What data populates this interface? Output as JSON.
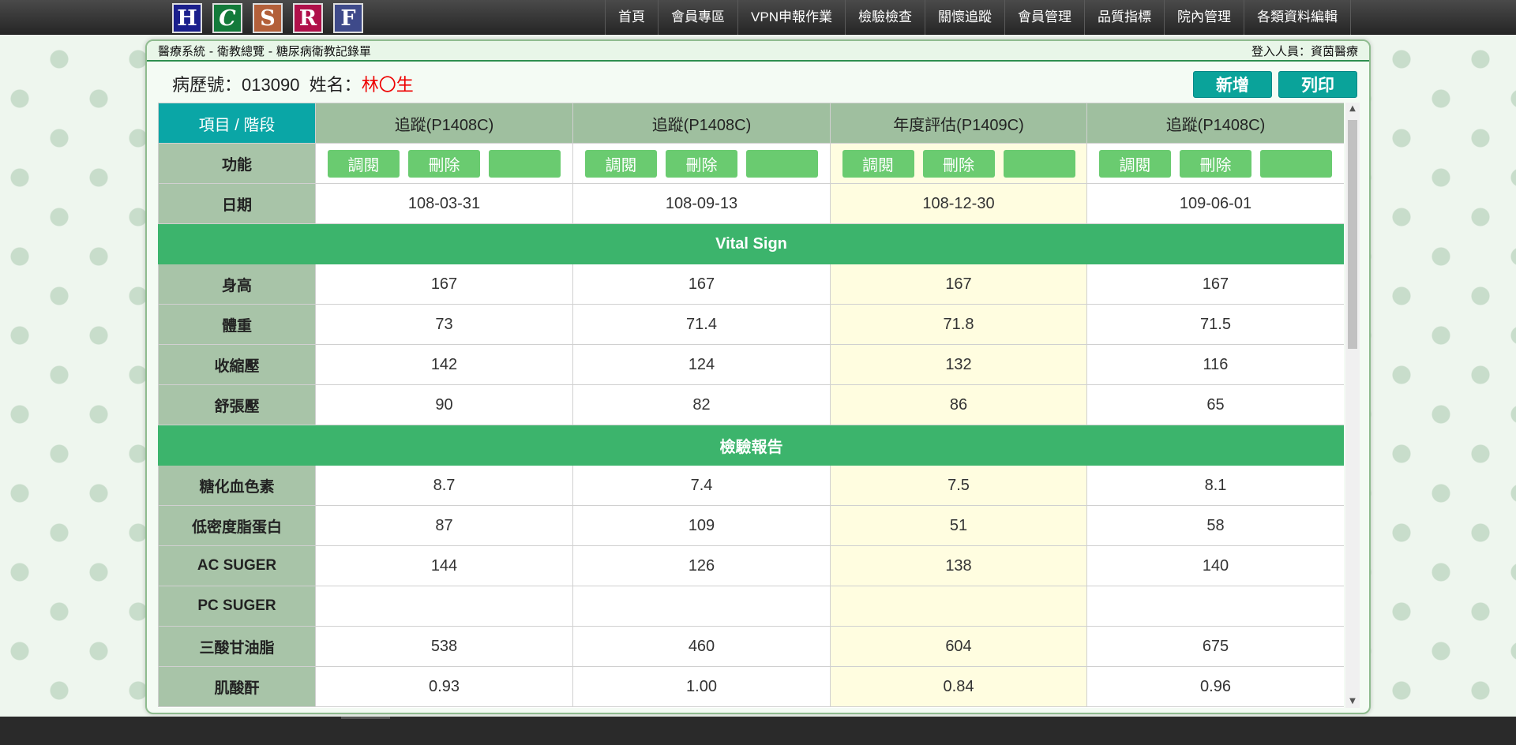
{
  "logos": [
    {
      "letter": "H",
      "color": "#1a1f8c"
    },
    {
      "letter": "C",
      "color": "#137a3a"
    },
    {
      "letter": "S",
      "color": "#b3603a"
    },
    {
      "letter": "R",
      "color": "#b0104a"
    },
    {
      "letter": "F",
      "color": "#3e4a8a"
    }
  ],
  "nav": [
    "首頁",
    "會員專區",
    "VPN申報作業",
    "檢驗檢查",
    "關懷追蹤",
    "會員管理",
    "品質指標",
    "院內管理",
    "各類資料編輯"
  ],
  "header": {
    "breadcrumb": "醫療系統 - 衛教總覽 - 糖尿病衛教記錄單",
    "user": "登入人員：資茵醫療"
  },
  "patient": {
    "record_label": "病歷號：",
    "record_no": "013090",
    "name_label": "姓名：",
    "name": "林〇生"
  },
  "buttons": {
    "add": "新增",
    "print": "列印"
  },
  "table": {
    "corner": "項目 / 階段",
    "columns": [
      "追蹤(P1408C)",
      "追蹤(P1408C)",
      "年度評估(P1409C)",
      "追蹤(P1408C)"
    ],
    "func_label": "功能",
    "view_label": "調閱",
    "delete_label": "刪除",
    "date_label": "日期",
    "dates": [
      "108-03-31",
      "108-09-13",
      "108-12-30",
      "109-06-01"
    ],
    "sections": [
      {
        "title": "Vital Sign",
        "rows": [
          {
            "label": "身高",
            "values": [
              "167",
              "167",
              "167",
              "167"
            ]
          },
          {
            "label": "體重",
            "values": [
              "73",
              "71.4",
              "71.8",
              "71.5"
            ]
          },
          {
            "label": "收縮壓",
            "values": [
              "142",
              "124",
              "132",
              "116"
            ]
          },
          {
            "label": "舒張壓",
            "values": [
              "90",
              "82",
              "86",
              "65"
            ]
          }
        ]
      },
      {
        "title": "檢驗報告",
        "rows": [
          {
            "label": "糖化血色素",
            "values": [
              "8.7",
              "7.4",
              "7.5",
              "8.1"
            ]
          },
          {
            "label": "低密度脂蛋白",
            "values": [
              "87",
              "109",
              "51",
              "58"
            ]
          },
          {
            "label": "AC SUGER",
            "values": [
              "144",
              "126",
              "138",
              "140"
            ]
          },
          {
            "label": "PC SUGER",
            "values": [
              "",
              "",
              "",
              ""
            ]
          },
          {
            "label": "三酸甘油脂",
            "values": [
              "538",
              "460",
              "604",
              "675"
            ]
          },
          {
            "label": "肌酸酐",
            "values": [
              "0.93",
              "1.00",
              "0.84",
              "0.96"
            ]
          }
        ]
      }
    ]
  }
}
